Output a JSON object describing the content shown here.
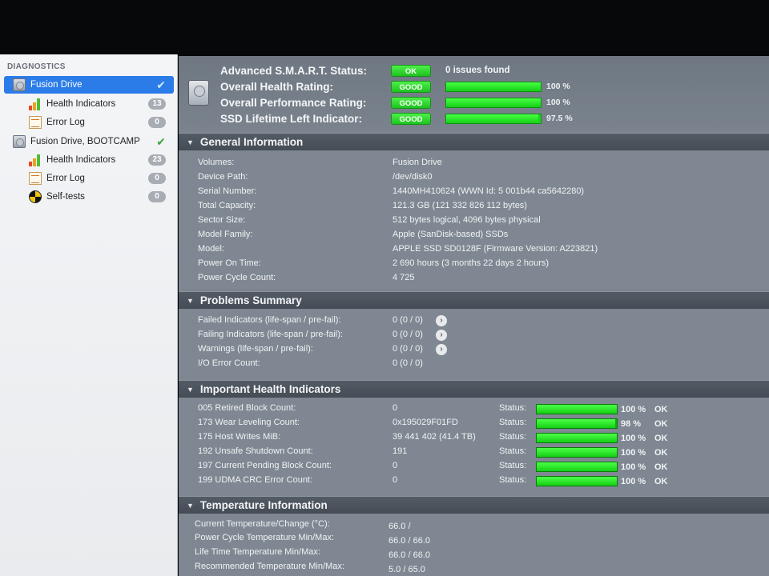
{
  "sidebar": {
    "heading": "DIAGNOSTICS",
    "items": [
      {
        "label": "Fusion Drive",
        "icon": "disk-icon",
        "status": "check"
      },
      {
        "label": "Health Indicators",
        "icon": "health-bars-icon",
        "badge": "13"
      },
      {
        "label": "Error Log",
        "icon": "log-icon",
        "badge": "0"
      },
      {
        "label": "Fusion Drive, BOOTCAMP",
        "icon": "disk-icon",
        "status": "check"
      },
      {
        "label": "Health Indicators",
        "icon": "health-bars-icon",
        "badge": "23"
      },
      {
        "label": "Error Log",
        "icon": "log-icon",
        "badge": "0"
      },
      {
        "label": "Self-tests",
        "icon": "self-test-icon",
        "badge": "0"
      }
    ]
  },
  "summary": {
    "smart": {
      "label": "Advanced S.M.A.R.T. Status:",
      "pill": "OK",
      "text": "0 issues found"
    },
    "health": {
      "label": "Overall Health Rating:",
      "pill": "GOOD",
      "percent": "100 %",
      "level": 100
    },
    "performance": {
      "label": "Overall Performance Rating:",
      "pill": "GOOD",
      "percent": "100 %",
      "level": 100
    },
    "lifetime": {
      "label": "SSD Lifetime Left Indicator:",
      "pill": "GOOD",
      "percent": "97.5 %",
      "level": 97.5
    }
  },
  "general": {
    "title": "General Information",
    "rows": [
      {
        "label": "Volumes:",
        "value": "Fusion Drive"
      },
      {
        "label": "Device Path:",
        "value": "/dev/disk0"
      },
      {
        "label": "Serial Number:",
        "value": "1440MH410624 (WWN Id: 5 001b44 ca5642280)"
      },
      {
        "label": "Total Capacity:",
        "value": "121.3 GB (121 332 826 112 bytes)"
      },
      {
        "label": "Sector Size:",
        "value": "512 bytes logical, 4096 bytes physical"
      },
      {
        "label": "Model Family:",
        "value": "Apple (SanDisk-based) SSDs"
      },
      {
        "label": "Model:",
        "value": "APPLE SSD SD0128F  (Firmware Version: A223821)"
      },
      {
        "label": "Power On Time:",
        "value": "2 690 hours (3 months 22 days 2 hours)"
      },
      {
        "label": "Power Cycle Count:",
        "value": "4 725"
      }
    ]
  },
  "problems": {
    "title": "Problems Summary",
    "rows": [
      {
        "label": "Failed Indicators (life-span / pre-fail):",
        "value": "0 (0 / 0)",
        "has_button": true
      },
      {
        "label": "Failing Indicators (life-span / pre-fail):",
        "value": "0 (0 / 0)",
        "has_button": true
      },
      {
        "label": "Warnings (life-span / pre-fail):",
        "value": "0 (0 / 0)",
        "has_button": true
      },
      {
        "label": "I/O Error Count:",
        "value": "0 (0 / 0)",
        "has_button": false
      }
    ]
  },
  "health_indicators": {
    "title": "Important Health Indicators",
    "status_label": "Status:",
    "rows": [
      {
        "label": "005  Retired Block Count:",
        "value": "0",
        "percent": "100 %",
        "level": 100,
        "state": "OK"
      },
      {
        "label": "173  Wear Leveling Count:",
        "value": "0x195029F01FD",
        "percent": "98 %",
        "level": 98,
        "state": "OK"
      },
      {
        "label": "175  Host Writes MiB:",
        "value": "39 441 402 (41.4 TB)",
        "percent": "100 %",
        "level": 100,
        "state": "OK"
      },
      {
        "label": "192  Unsafe Shutdown Count:",
        "value": "191",
        "percent": "100 %",
        "level": 100,
        "state": "OK"
      },
      {
        "label": "197  Current Pending Block Count:",
        "value": "0",
        "percent": "100 %",
        "level": 100,
        "state": "OK"
      },
      {
        "label": "199  UDMA CRC Error Count:",
        "value": "0",
        "percent": "100 %",
        "level": 100,
        "state": "OK"
      }
    ]
  },
  "temperature": {
    "title": "Temperature Information",
    "rows": [
      {
        "label": "Current Temperature/Change (°C):",
        "value": "66.0 /"
      },
      {
        "label": "Power Cycle Temperature Min/Max:",
        "value": "66.0 / 66.0"
      },
      {
        "label": "Life Time Temperature Min/Max:",
        "value": "66.0 / 66.0"
      },
      {
        "label": "Recommended Temperature Min/Max:",
        "value": "5.0  / 65.0"
      }
    ]
  },
  "colors": {
    "selection": "#2b7ce9",
    "good": "#1ec21e",
    "panel": "#7f8892",
    "header": "#4a525b"
  }
}
